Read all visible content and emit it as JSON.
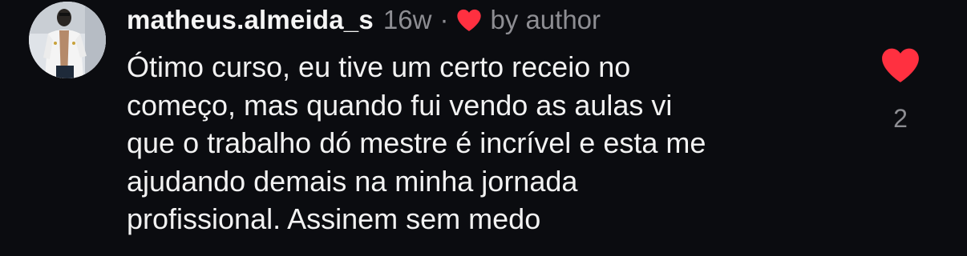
{
  "comment": {
    "username": "matheus.almeida_s",
    "time": "16w",
    "separator": "·",
    "author_like_label": "by author",
    "text": "Ótimo curso, eu tive um certo receio no\ncomeço, mas quando fui vendo as aulas vi\nque o trabalho dó mestre é incrível e esta me\najudando demais na minha jornada\nprofissional. Assinem sem medo",
    "like_count": "2",
    "like_icon": "heart-filled-icon",
    "author_heart_icon": "heart-filled-icon",
    "avatar_icon": "profile-photo"
  },
  "colors": {
    "background": "#0b0c10",
    "heart": "#ff3040",
    "muted_text": "#8e8e93",
    "primary_text": "#f2f2f2"
  }
}
